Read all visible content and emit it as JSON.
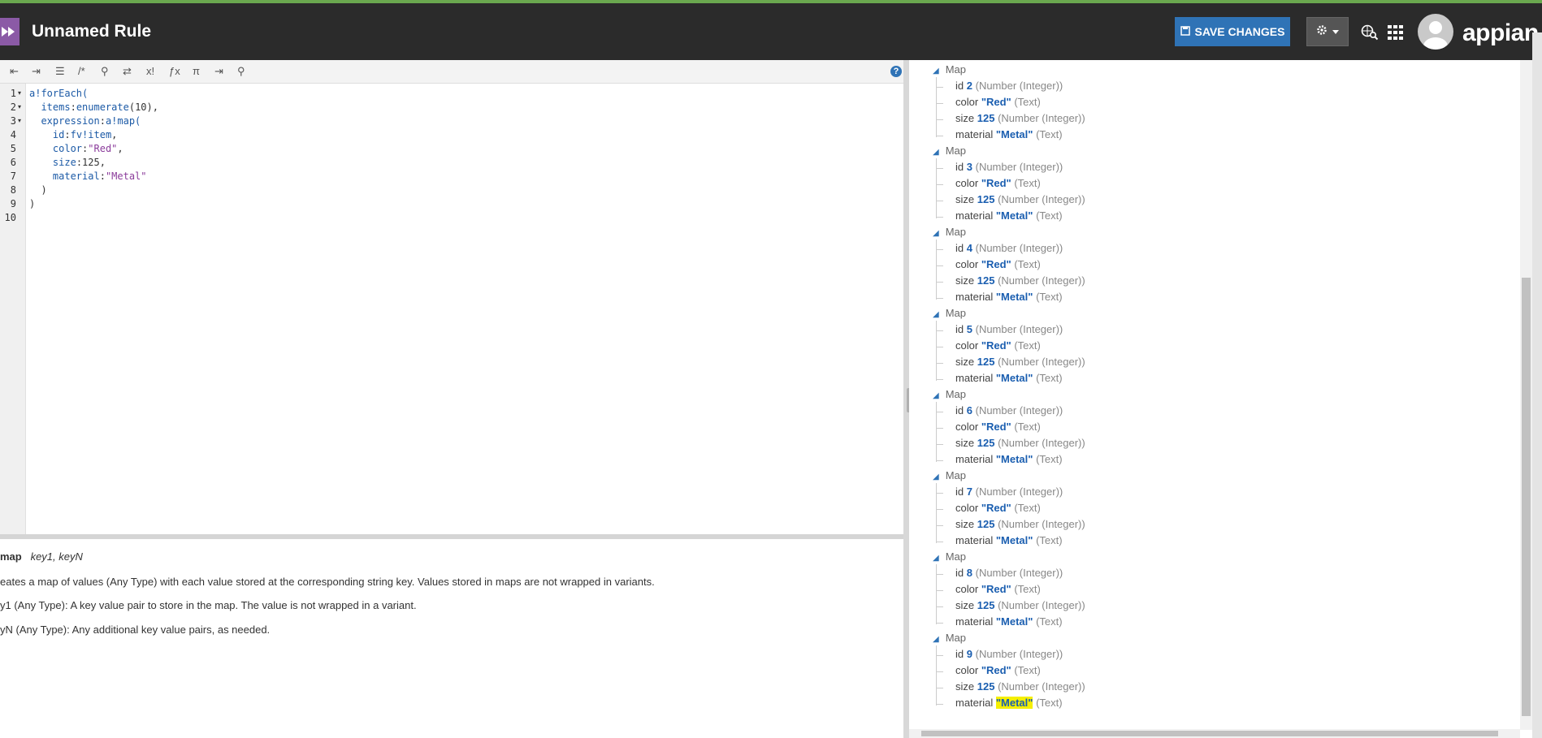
{
  "header": {
    "title": "Unnamed Rule",
    "save_label": "SAVE CHANGES",
    "brand": "appian"
  },
  "editor": {
    "line_numbers": [
      "1",
      "2",
      "3",
      "4",
      "5",
      "6",
      "7",
      "8",
      "9",
      "10"
    ]
  },
  "docs": {
    "signature_name": "map",
    "signature_params": "key1, keyN",
    "description": "eates a map of values (Any Type) with each value stored at the corresponding string key. Values stored in maps are not wrapped in variants.",
    "param1": "y1 (Any Type): A key value pair to store in the map. The value is not wrapped in a variant.",
    "paramN": "yN (Any Type): Any additional key value pairs, as needed."
  },
  "result": {
    "map_label": "Map",
    "maps": [
      {
        "id": "2",
        "color": "\"Red\"",
        "size": "125",
        "material": "\"Metal\""
      },
      {
        "id": "3",
        "color": "\"Red\"",
        "size": "125",
        "material": "\"Metal\""
      },
      {
        "id": "4",
        "color": "\"Red\"",
        "size": "125",
        "material": "\"Metal\""
      },
      {
        "id": "5",
        "color": "\"Red\"",
        "size": "125",
        "material": "\"Metal\""
      },
      {
        "id": "6",
        "color": "\"Red\"",
        "size": "125",
        "material": "\"Metal\""
      },
      {
        "id": "7",
        "color": "\"Red\"",
        "size": "125",
        "material": "\"Metal\""
      },
      {
        "id": "8",
        "color": "\"Red\"",
        "size": "125",
        "material": "\"Metal\""
      },
      {
        "id": "9",
        "color": "\"Red\"",
        "size": "125",
        "material": "\"Metal\""
      }
    ],
    "keys": {
      "id": "id",
      "color": "color",
      "size": "size",
      "material": "material"
    },
    "types": {
      "integer": "(Number (Integer))",
      "text": "(Text)"
    }
  },
  "colors": {
    "header_bg": "#2b2b2b",
    "save_button": "#2f73b6",
    "value_blue": "#1a5eb0",
    "highlight": "#f5ef00"
  }
}
